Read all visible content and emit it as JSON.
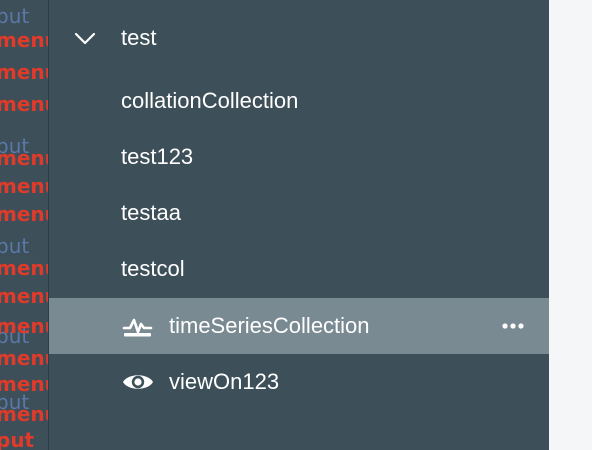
{
  "background_fragments": {
    "words": [
      "put",
      "menu",
      "menu",
      "menu",
      "put",
      "menu",
      "menu",
      "menu",
      "put",
      "menu",
      "menu",
      "put",
      "menu",
      "menu",
      "put",
      "menu",
      "menu",
      "put",
      "menu",
      "menu",
      "menu"
    ]
  },
  "sidebar": {
    "database": {
      "name": "test",
      "expanded": true
    },
    "collections": [
      {
        "name": "collationCollection",
        "icon": "none"
      },
      {
        "name": "test123",
        "icon": "none"
      },
      {
        "name": "testaa",
        "icon": "none"
      },
      {
        "name": "testcol",
        "icon": "none"
      },
      {
        "name": "timeSeriesCollection",
        "icon": "time-series-icon",
        "active": true,
        "more": "more-options-icon"
      },
      {
        "name": "viewOn123",
        "icon": "eye-icon"
      }
    ]
  },
  "colors": {
    "sidebar_bg": "#3d4f58",
    "active_row_bg": "#7a8a92",
    "text": "#ffffff",
    "fragment_red": "#e03a2b",
    "fragment_blue": "#5b78a8",
    "page_bg": "#f5f6f7"
  }
}
